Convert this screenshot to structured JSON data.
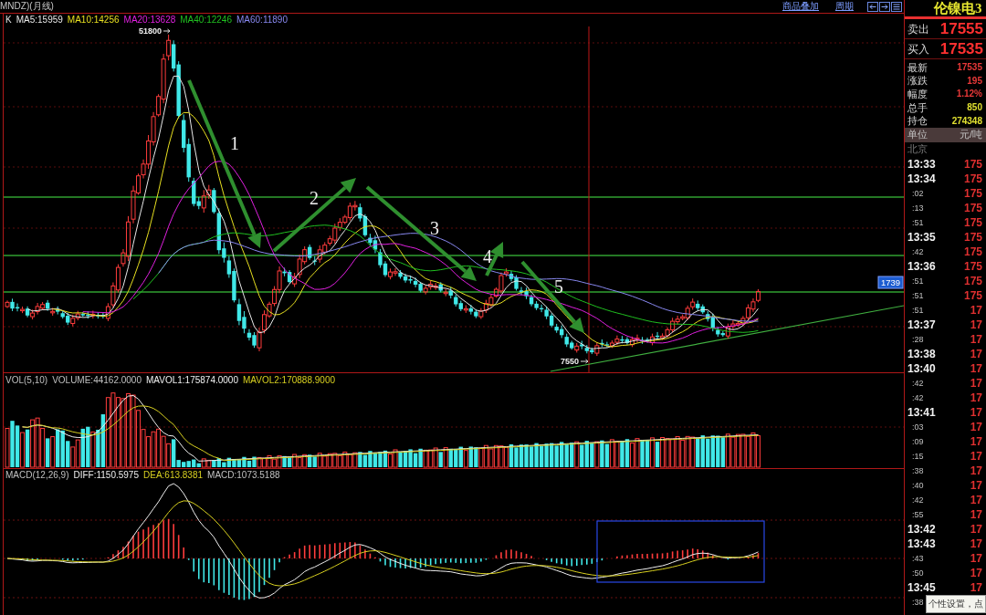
{
  "top_bar": {
    "title": "MNDZ)(月线)",
    "links": [
      "商品叠加",
      "周期"
    ]
  },
  "price_panel": {
    "indicator": "K",
    "ma_readouts": [
      {
        "text": "MA5:15959",
        "color": "#e8e8e8"
      },
      {
        "text": "MA10:14256",
        "color": "#e8e020"
      },
      {
        "text": "MA20:13628",
        "color": "#e020e0"
      },
      {
        "text": "MA40:12246",
        "color": "#20c020"
      },
      {
        "text": "MA60:11890",
        "color": "#8888f0"
      }
    ],
    "high_label": "51800",
    "low_label": "7550",
    "wave_labels": [
      "1",
      "2",
      "3",
      "4",
      "5"
    ],
    "price_tag": "1739"
  },
  "volume_panel": {
    "label": "VOL(5,10)",
    "readouts": [
      {
        "text": "VOLUME:44162.0000",
        "color": "#c0c0c0"
      },
      {
        "text": "MAVOL1:175874.0000",
        "color": "#f0f0f0"
      },
      {
        "text": "MAVOL2:170888.9000",
        "color": "#d8d020"
      }
    ]
  },
  "macd_panel": {
    "label": "MACD(12,26,9)",
    "readouts": [
      {
        "text": "DIFF:1150.5975",
        "color": "#f0f0f0"
      },
      {
        "text": "DEA:613.8381",
        "color": "#d8d020"
      },
      {
        "text": "MACD:1073.5188",
        "color": "#c0c0c0"
      }
    ]
  },
  "quote_panel": {
    "title": "伦镍电3",
    "sell": {
      "label": "卖出",
      "value": "17555"
    },
    "buy": {
      "label": "买入",
      "value": "17535"
    },
    "stats": [
      {
        "label": "最新",
        "value": "17535",
        "color": "#e83838"
      },
      {
        "label": "涨跌",
        "value": "195",
        "color": "#e83838"
      },
      {
        "label": "幅度",
        "value": "1.12%",
        "color": "#e83838"
      },
      {
        "label": "总手",
        "value": "850",
        "color": "#e0e030"
      },
      {
        "label": "持仓",
        "value": "274348",
        "color": "#e0e030"
      }
    ],
    "unit": {
      "label": "单位",
      "value": "元/吨"
    },
    "ticks_header": "北京",
    "ticks": [
      {
        "time": "13:33",
        "price": "175",
        "kind": "minute"
      },
      {
        "time": "13:34",
        "price": "175",
        "kind": "minute"
      },
      {
        "time": ":02",
        "price": "175",
        "kind": "second"
      },
      {
        "time": ":13",
        "price": "175",
        "kind": "second"
      },
      {
        "time": ":51",
        "price": "175",
        "kind": "second"
      },
      {
        "time": "13:35",
        "price": "175",
        "kind": "minute"
      },
      {
        "time": ":42",
        "price": "175",
        "kind": "second"
      },
      {
        "time": "13:36",
        "price": "175",
        "kind": "minute"
      },
      {
        "time": ":51",
        "price": "175",
        "kind": "second"
      },
      {
        "time": ":51",
        "price": "175",
        "kind": "second"
      },
      {
        "time": ":51",
        "price": "17",
        "kind": "second"
      },
      {
        "time": "13:37",
        "price": "17",
        "kind": "minute"
      },
      {
        "time": ":28",
        "price": "17",
        "kind": "second"
      },
      {
        "time": "13:38",
        "price": "17",
        "kind": "minute"
      },
      {
        "time": "13:40",
        "price": "17",
        "kind": "minute"
      },
      {
        "time": ":42",
        "price": "17",
        "kind": "second"
      },
      {
        "time": ":42",
        "price": "17",
        "kind": "second"
      },
      {
        "time": "13:41",
        "price": "17",
        "kind": "minute"
      },
      {
        "time": ":03",
        "price": "17",
        "kind": "second"
      },
      {
        "time": ":09",
        "price": "17",
        "kind": "second"
      },
      {
        "time": ":15",
        "price": "17",
        "kind": "second"
      },
      {
        "time": ":38",
        "price": "17",
        "kind": "second"
      },
      {
        "time": ":40",
        "price": "17",
        "kind": "second"
      },
      {
        "time": ":42",
        "price": "17",
        "kind": "second"
      },
      {
        "time": ":55",
        "price": "17",
        "kind": "second"
      },
      {
        "time": "13:42",
        "price": "17",
        "kind": "minute"
      },
      {
        "time": "13:43",
        "price": "17",
        "kind": "minute"
      },
      {
        "time": ":43",
        "price": "17",
        "kind": "second"
      },
      {
        "time": ":50",
        "price": "17",
        "kind": "second"
      },
      {
        "time": "13:45",
        "price": "17",
        "kind": "minute"
      },
      {
        "time": ":38",
        "kind": "second"
      }
    ]
  },
  "tooltip": "个性设置，点"
}
